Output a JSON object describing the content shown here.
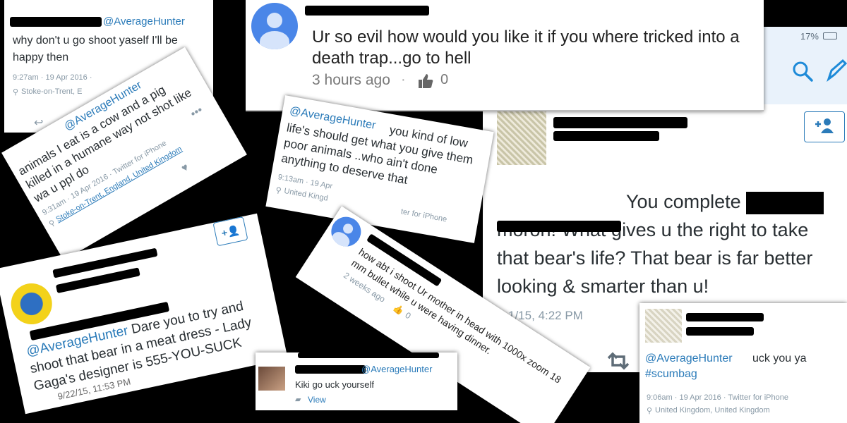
{
  "card1": {
    "handle": "@AverageHunter",
    "text": "why don't u go shoot yaself I'll be happy then",
    "time": "9:27am · 19 Apr 2016 ·",
    "location": "Stoke-on-Trent, E"
  },
  "card2": {
    "text": "Ur so evil how would you like it if you where tricked into a death trap...go to hell",
    "time": "3 hours ago",
    "likes": "0"
  },
  "card3": {
    "battery": "17%",
    "text_tail": "You complete",
    "text_body": "moron! What gives u the right to take that bear's life? That bear is far better looking & smarter than u!",
    "time": "1/15, 4:22 PM"
  },
  "card4": {
    "handle": "@AverageHunter",
    "text": "animals I eat is a cow and a pig killed in a humane way not shot like wa u ppl do",
    "time": "9:31am · 19 Apr 2016 · Twitter for iPhone",
    "location": "Stoke-on-Trent, England, United Kingdom"
  },
  "card5": {
    "handle": "@AverageHunter",
    "text": "you kind of low life's should get what you give them poor animals ..who ain't done anything to deserve that",
    "time": "9:13am · 19 Apr",
    "source": "ter for iPhone",
    "location": "United Kingd"
  },
  "card6": {
    "handle": "@AverageHunter",
    "text": "Dare you to try and shoot that bear in a meat dress - Lady Gaga's designer is 555-YOU-SUCK",
    "time": "9/22/15, 11:53 PM"
  },
  "card7": {
    "text": "how abt i shoot Ur mother in head with 1000x zoom 18 mm bullet while u were having dinner.",
    "time": "2 weeks ago",
    "likes": "0"
  },
  "card8": {
    "handle": "@AverageHunter",
    "text": "Kiki go  uck yourself",
    "view": "View"
  },
  "card9": {
    "handle": "@AverageHunter",
    "text": "uck you ya",
    "hashtag": "#scumbag",
    "time": "9:06am · 19 Apr 2016 · Twitter for iPhone",
    "location": "United Kingdom, United Kingdom"
  },
  "colors": {
    "link": "#2b7bb9",
    "muted": "#8899a6",
    "background": "#000000",
    "google_blue": "#4a86e8"
  },
  "icons": [
    "reply-icon",
    "location-pin-icon",
    "thumbs-up-icon",
    "heart-icon",
    "more-icon",
    "add-user-icon",
    "search-icon",
    "compose-icon",
    "retweet-icon",
    "comment-icon"
  ]
}
